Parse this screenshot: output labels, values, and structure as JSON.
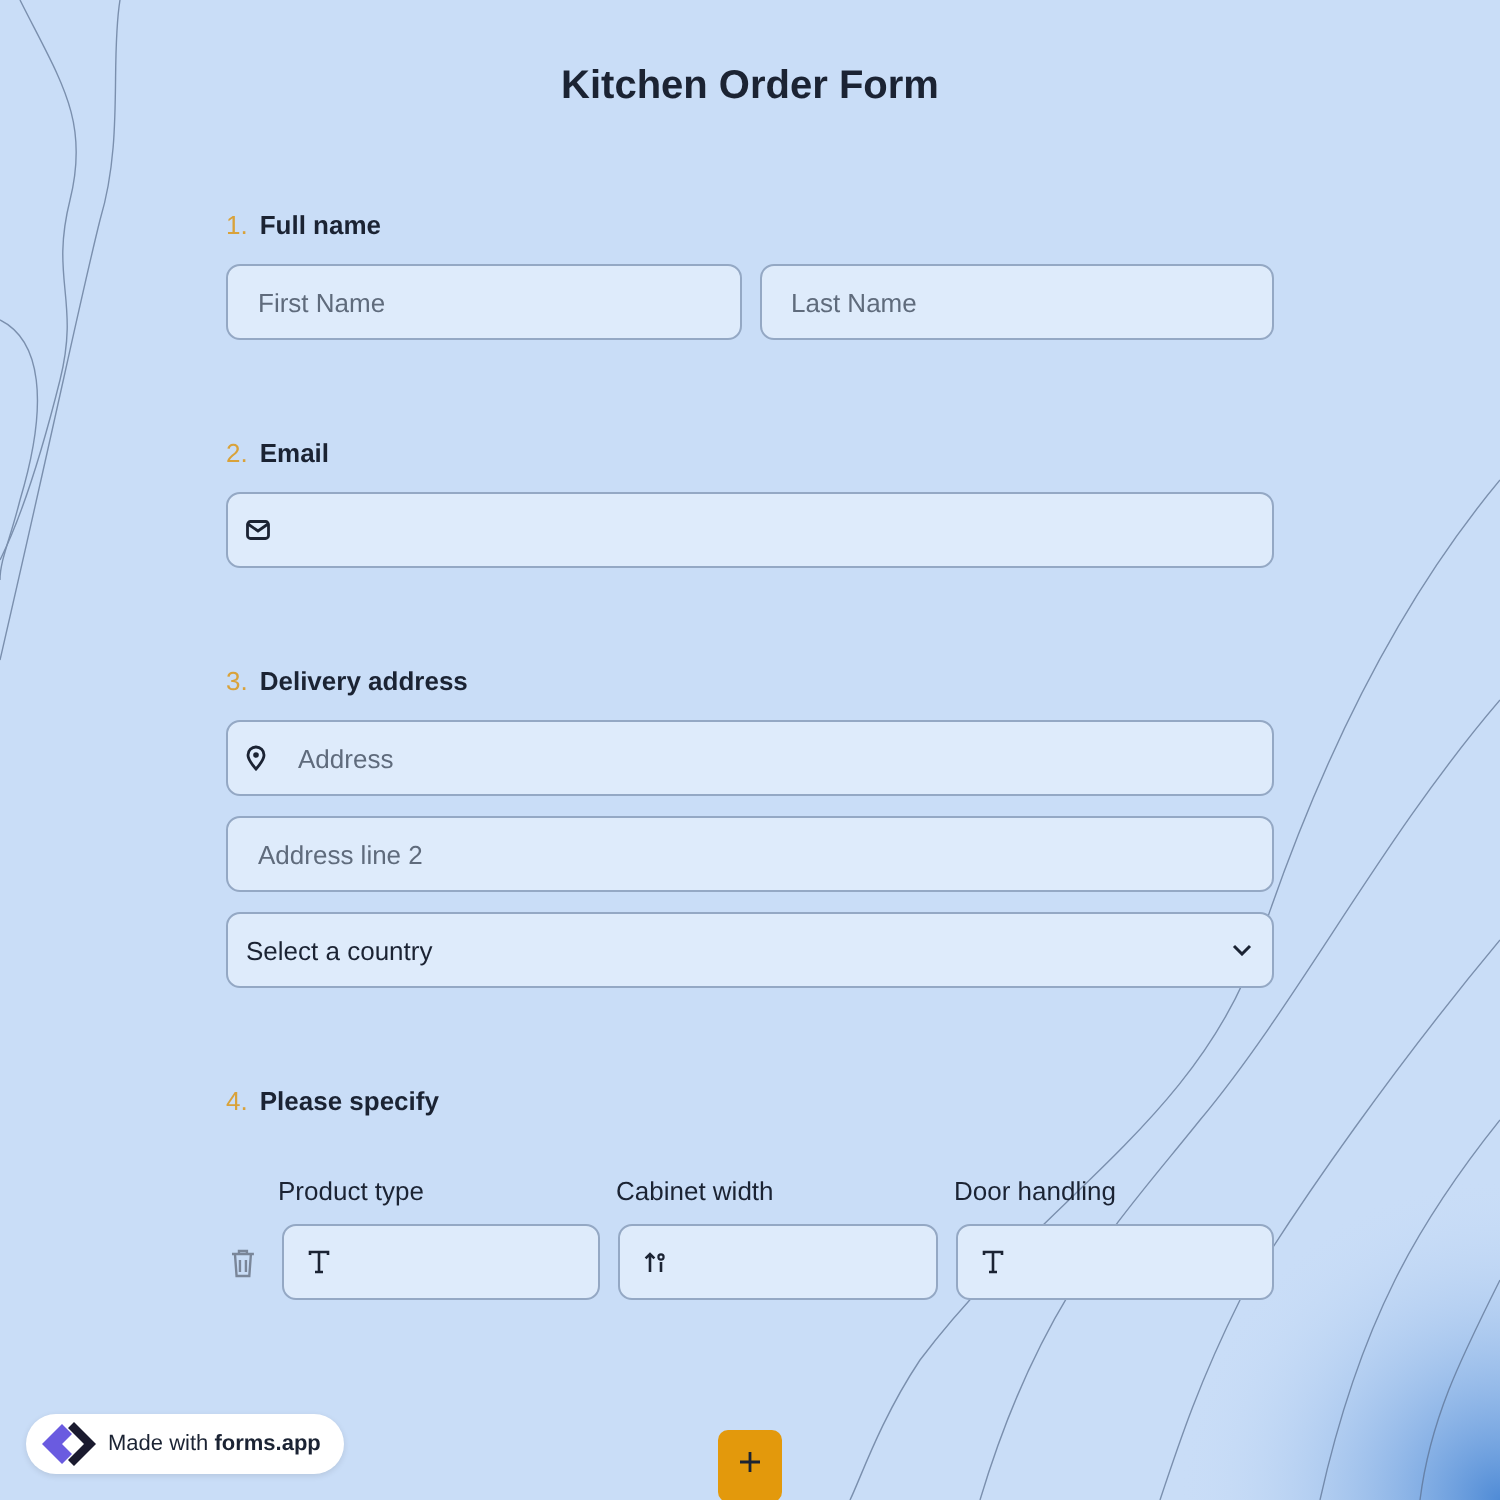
{
  "title": "Kitchen Order Form",
  "questions": [
    {
      "number": "1.",
      "label": "Full name",
      "kind": "fields",
      "fields": [
        {
          "kind": "text",
          "placeholder": "First Name"
        },
        {
          "kind": "text",
          "placeholder": "Last Name"
        }
      ]
    },
    {
      "number": "2.",
      "label": "Email",
      "kind": "fields",
      "fields": [
        {
          "kind": "email"
        }
      ]
    },
    {
      "number": "3.",
      "label": "Delivery address",
      "kind": "fields",
      "fields": [
        {
          "kind": "address",
          "placeholder": "Address"
        },
        {
          "kind": "text",
          "placeholder": "Address line 2"
        },
        {
          "kind": "select",
          "value": "Select a country"
        }
      ]
    },
    {
      "number": "4.",
      "label": "Please specify",
      "kind": "table",
      "columns": [
        {
          "label": "Product type",
          "kind": "text"
        },
        {
          "label": "Cabinet width",
          "kind": "number"
        },
        {
          "label": "Door handling",
          "kind": "text"
        }
      ]
    }
  ],
  "badge": "Made with **forms.app**"
}
